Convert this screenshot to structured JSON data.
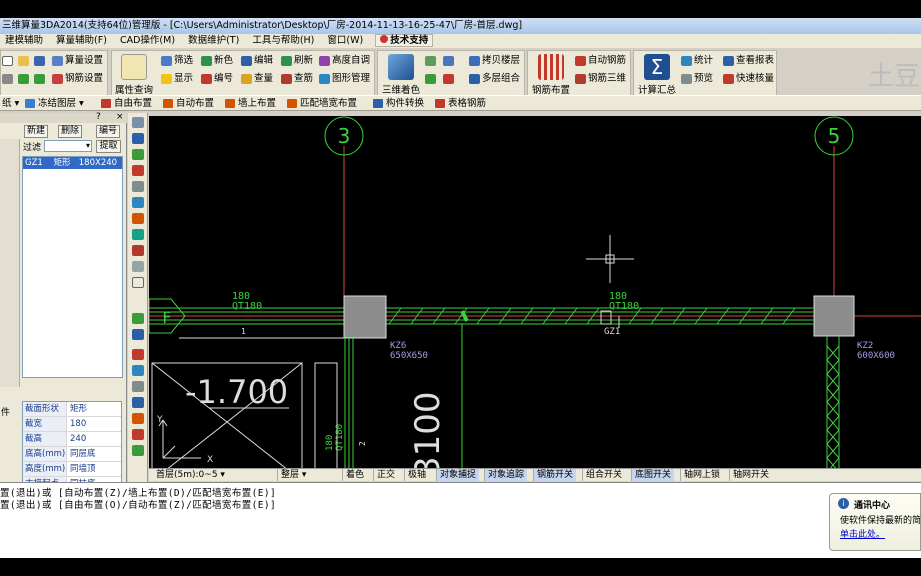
{
  "window": {
    "title": "三维算量3DA2014(支持64位)管理版 - [C:\\Users\\Administrator\\Desktop\\厂房-2014-11-13-16-25-47\\厂房-首层.dwg]"
  },
  "menu": {
    "items": [
      "建模辅助",
      "算量辅助(F)",
      "CAD操作(M)",
      "数据维护(T)",
      "工具与帮助(H)",
      "窗口(W)"
    ],
    "tech_support": "技术支持"
  },
  "toolbar": {
    "g1": [
      "算量设置",
      "钢筋设置"
    ],
    "g2": {
      "big": "属性查询",
      "small": [
        "筛选",
        "显示",
        "新色",
        "编号",
        "编辑",
        "查量",
        "刷新",
        "查筋",
        "高度自调",
        "图形管理"
      ]
    },
    "g3": {
      "big": "三维着色",
      "small": [
        "拷贝楼层",
        "多层组合"
      ]
    },
    "g4": {
      "big": "钢筋布置",
      "small": [
        "自动钢筋",
        "钢筋三维"
      ]
    },
    "g5": {
      "big": "计算汇总",
      "small": [
        "统计",
        "预览",
        "查看报表",
        "快速核量"
      ]
    },
    "ghost_text": "土豆"
  },
  "toolbar2": {
    "items": [
      "纸",
      "冻结图层",
      "自由布置",
      "自动布置",
      "墙上布置",
      "匹配墙宽布置",
      "构件转换",
      "表格钢筋"
    ]
  },
  "left_panel": {
    "buttons": [
      "新建",
      "删除",
      "编号"
    ],
    "question": "?",
    "filter_label": "过滤",
    "extract": "提取",
    "components": [
      {
        "code": "GZ1",
        "shape": "矩形",
        "size": "180X240"
      }
    ],
    "side_label": "件",
    "properties": [
      {
        "key": "截面形状",
        "value": "矩形"
      },
      {
        "key": "截宽",
        "value": "180"
      },
      {
        "key": "截高",
        "value": "240"
      },
      {
        "key": "底高(mm)",
        "value": "同层底"
      },
      {
        "key": "高度(mm)",
        "value": "同墙顶"
      },
      {
        "key": "支模起点",
        "value": "同柱底"
      }
    ]
  },
  "drawing": {
    "axis_bubbles": [
      "3",
      "5"
    ],
    "left_bubble": "F",
    "wall_label_1": {
      "width": "180",
      "code": "QT180"
    },
    "wall_label_2": {
      "width": "180",
      "code": "QT180"
    },
    "col_kz6": {
      "code": "KZ6",
      "size": "650X650"
    },
    "col_kz2": {
      "code": "KZ2",
      "size": "600X600"
    },
    "gz_label": "GZ1",
    "tick_1": "1",
    "tick_2": "2",
    "elevation": "-1.700",
    "dimension": "3100",
    "vert_wall": {
      "width": "180",
      "code": "QT180"
    },
    "ucs": {
      "x": "X",
      "y": "Y"
    }
  },
  "statusbar": {
    "floor": "首层(5m):0~5",
    "layer": "整层",
    "toggles": [
      {
        "label": "着色",
        "on": false
      },
      {
        "label": "正交",
        "on": false
      },
      {
        "label": "极轴",
        "on": false
      },
      {
        "label": "对象捕捉",
        "on": true
      },
      {
        "label": "对象追踪",
        "on": true
      },
      {
        "label": "钢筋开关",
        "on": true
      },
      {
        "label": "组合开关",
        "on": false
      },
      {
        "label": "底图开关",
        "on": true
      },
      {
        "label": "轴网上锁",
        "on": false
      },
      {
        "label": "轴网开关",
        "on": false
      }
    ]
  },
  "command": {
    "line1": "置(退出)或 [自动布置(Z)/墙上布置(D)/匹配墙宽布置(E)]",
    "line2": "置(退出)或 [自由布置(O)/自动布置(Z)/匹配墙宽布置(E)]"
  },
  "notification": {
    "title": "通讯中心",
    "body": "使软件保持最新的简",
    "link": "单击此处。"
  }
}
